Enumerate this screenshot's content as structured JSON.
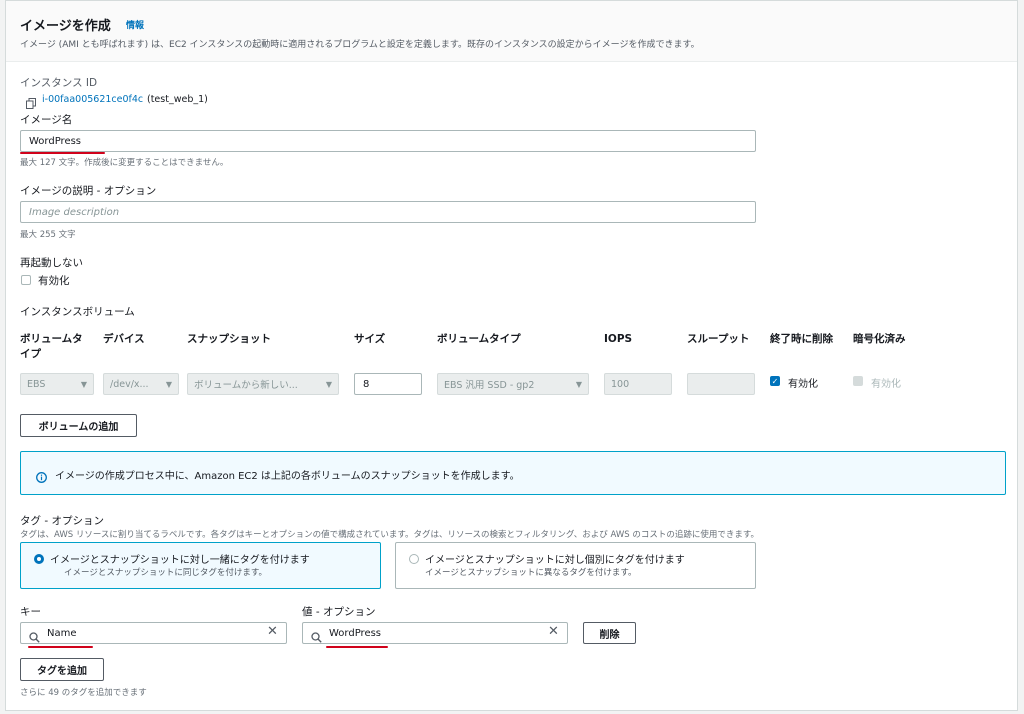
{
  "header": {
    "title": "イメージを作成",
    "info_link": "情報",
    "description": "イメージ (AMI とも呼ばれます) は、EC2 インスタンスの起動時に適用されるプログラムと設定を定義します。既存のインスタンスの設定からイメージを作成できます。"
  },
  "instance": {
    "label": "インスタンス ID",
    "id": "i-00faa005621ce0f4c",
    "name": "(test_web_1)"
  },
  "image_name": {
    "label": "イメージ名",
    "value": "WordPress",
    "hint": "最大 127 文字。作成後に変更することはできません。"
  },
  "image_desc": {
    "label": "イメージの説明 - オプション",
    "placeholder": "Image description",
    "hint": "最大 255 文字"
  },
  "no_reboot": {
    "label": "再起動しない",
    "option": "有効化"
  },
  "volumes": {
    "section_label": "インスタンスボリューム",
    "headers": {
      "type": "ボリュームタ\nイプ",
      "device": "デバイス",
      "snapshot": "スナップショット",
      "size": "サイズ",
      "vol_type": "ボリュームタイプ",
      "iops": "IOPS",
      "throughput": "スループット",
      "delete": "終了時に削除",
      "encrypted": "暗号化済み"
    },
    "row": {
      "type": "EBS",
      "device": "/dev/x...",
      "snapshot": "ボリュームから新しい...",
      "size": "8",
      "vol_type": "EBS 汎用 SSD - gp2",
      "iops": "100",
      "throughput": "",
      "delete_label": "有効化",
      "encrypted_label": "有効化"
    },
    "add_button": "ボリュームの追加"
  },
  "info_text": "イメージの作成プロセス中に、Amazon EC2 は上記の各ボリュームのスナップショットを作成します。",
  "tags": {
    "label": "タグ - オプション",
    "hint": "タグは、AWS リソースに割り当てるラベルです。各タグはキーとオプションの値で構成されています。タグは、リソースの検索とフィルタリング、および AWS のコストの追跡に使用できます。",
    "option1_title": "イメージとスナップショットに対し一緒にタグを付けます",
    "option1_desc": "イメージとスナップショットに同じタグを付けます。",
    "option2_title": "イメージとスナップショットに対し個別にタグを付けます",
    "option2_desc": "イメージとスナップショットに異なるタグを付けます。",
    "key_label": "キー",
    "value_label": "値 - オプション",
    "key_value": "Name",
    "value_value": "WordPress",
    "remove_button": "削除",
    "add_button": "タグを追加",
    "remaining": "さらに 49 のタグを追加できます"
  },
  "colors": {
    "link": "#0073bb",
    "annotation": "#d0021b",
    "info_border": "#00a1c9"
  }
}
